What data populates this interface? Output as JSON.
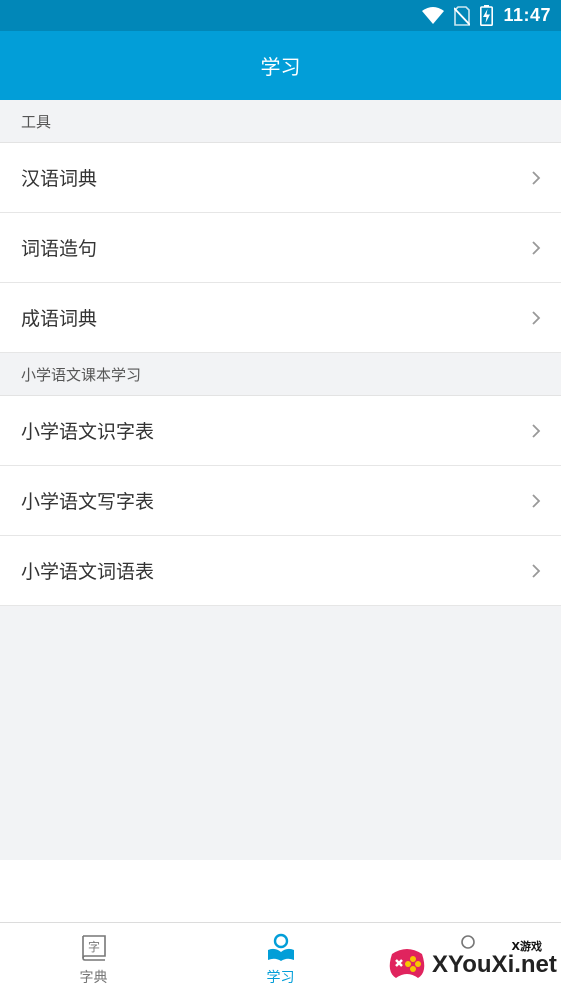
{
  "status_bar": {
    "time": "11:47",
    "icons": [
      "wifi-icon",
      "no-sim-icon",
      "battery-charging-icon"
    ]
  },
  "app_bar": {
    "title": "学习"
  },
  "sections": [
    {
      "header": "工具",
      "items": [
        {
          "label": "汉语词典",
          "icon": "chevron-right-icon"
        },
        {
          "label": "词语造句",
          "icon": "chevron-right-icon"
        },
        {
          "label": "成语词典",
          "icon": "chevron-right-icon"
        }
      ]
    },
    {
      "header": "小学语文课本学习",
      "items": [
        {
          "label": "小学语文识字表",
          "icon": "chevron-right-icon"
        },
        {
          "label": "小学语文写字表",
          "icon": "chevron-right-icon"
        },
        {
          "label": "小学语文词语表",
          "icon": "chevron-right-icon"
        }
      ]
    }
  ],
  "tab_bar": {
    "tabs": [
      {
        "label": "字典",
        "icon": "dictionary-book-icon",
        "active": false,
        "icon_char": "字"
      },
      {
        "label": "学习",
        "icon": "reading-person-icon",
        "active": true
      },
      {
        "label": "",
        "icon": "person-icon",
        "active": false
      }
    ]
  },
  "watermark": {
    "text": "XYouXi.net",
    "small": "X游戏"
  },
  "colors": {
    "status_bar": "#0187b8",
    "app_bar": "#029ed8",
    "accent": "#029ed8",
    "background": "#f2f3f5"
  }
}
